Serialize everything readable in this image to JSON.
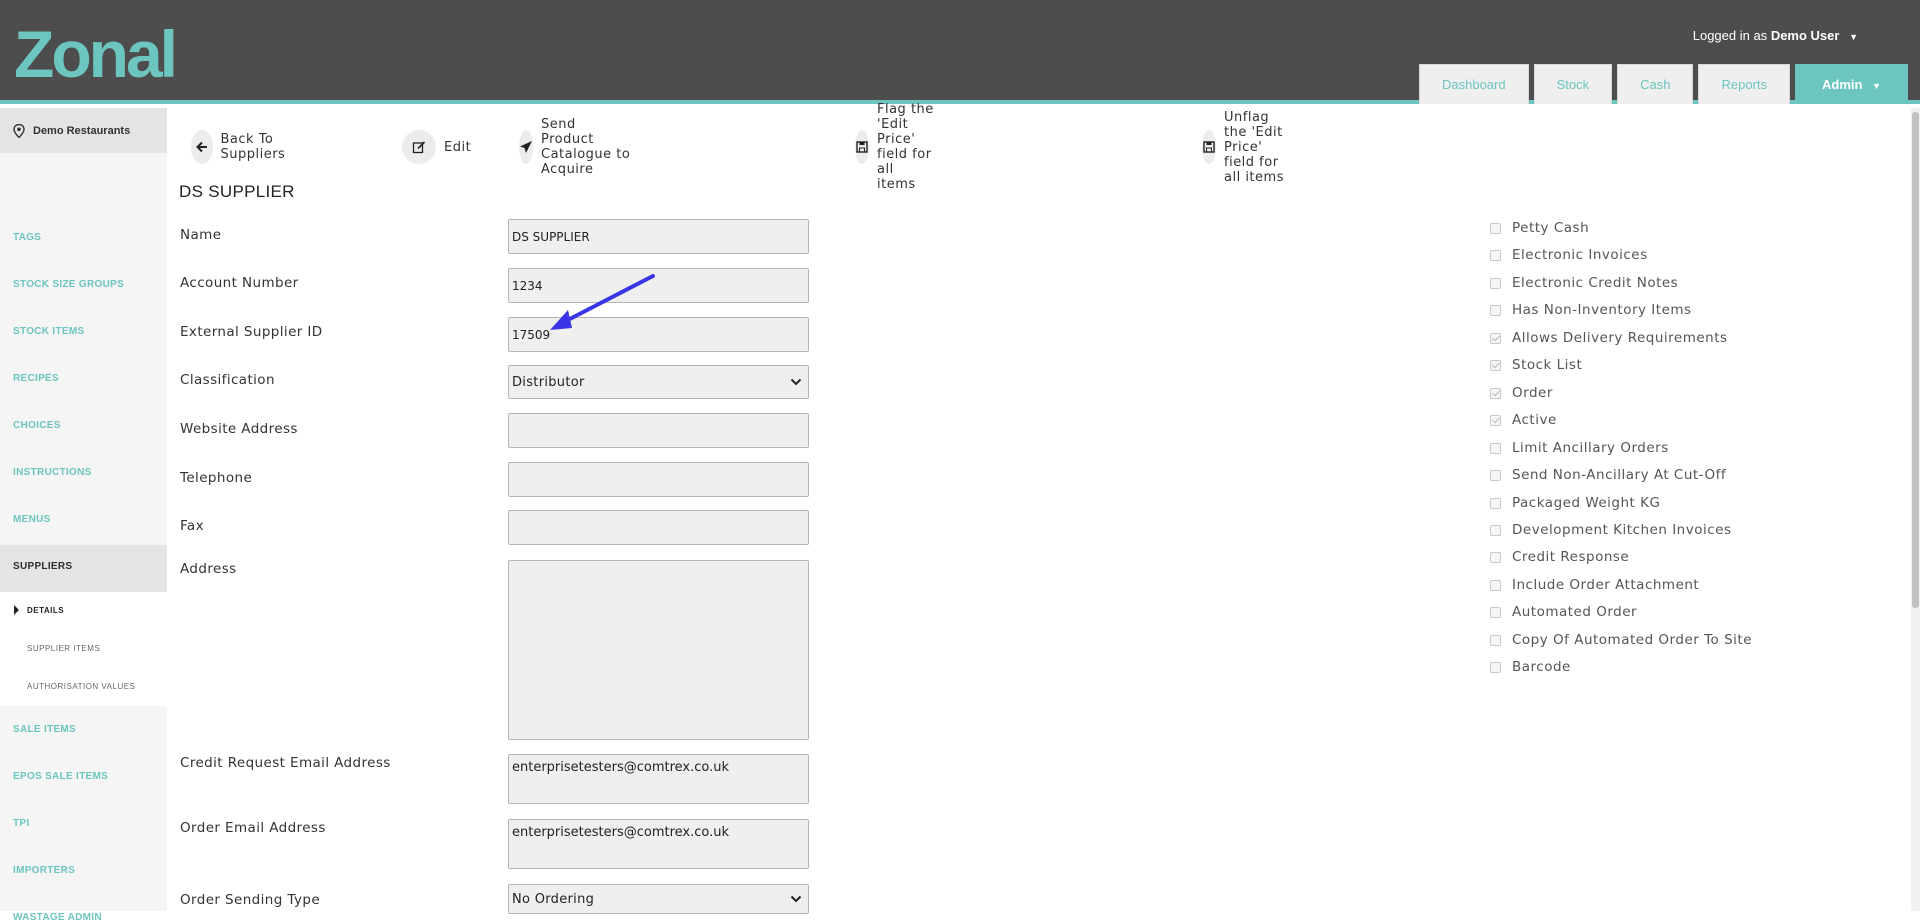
{
  "header": {
    "logo_text": "Zonal",
    "logged_prefix": "Logged in as",
    "logged_user": "Demo User",
    "nav": [
      {
        "label": "Dashboard"
      },
      {
        "label": "Stock"
      },
      {
        "label": "Cash"
      },
      {
        "label": "Reports"
      },
      {
        "label": "Admin"
      }
    ]
  },
  "sidebar": {
    "site_name": "Demo Restaurants",
    "items": [
      {
        "label": "TAGS"
      },
      {
        "label": "STOCK SIZE GROUPS"
      },
      {
        "label": "STOCK ITEMS"
      },
      {
        "label": "RECIPES"
      },
      {
        "label": "CHOICES"
      },
      {
        "label": "INSTRUCTIONS"
      },
      {
        "label": "MENUS"
      },
      {
        "label": "SUPPLIERS"
      },
      {
        "label": "SALE ITEMS"
      },
      {
        "label": "EPOS SALE ITEMS"
      },
      {
        "label": "TPI"
      },
      {
        "label": "IMPORTERS"
      },
      {
        "label": "WASTAGE ADMIN"
      }
    ],
    "sub_items": [
      {
        "label": "DETAILS"
      },
      {
        "label": "SUPPLIER ITEMS"
      },
      {
        "label": "AUTHORISATION VALUES"
      }
    ]
  },
  "toolbar": {
    "back": "Back To Suppliers",
    "edit": "Edit",
    "send": "Send Product Catalogue to Acquire",
    "flag": "Flag the 'Edit Price' field for all items",
    "unflag": "Unflag the 'Edit Price' field for all items"
  },
  "form": {
    "title": "DS SUPPLIER",
    "name_label": "Name",
    "name_value": "DS SUPPLIER",
    "account_label": "Account Number",
    "account_value": "1234",
    "external_label": "External Supplier ID",
    "external_value": "17509",
    "classification_label": "Classification",
    "classification_value": "Distributor",
    "website_label": "Website Address",
    "website_value": "",
    "telephone_label": "Telephone",
    "telephone_value": "",
    "fax_label": "Fax",
    "fax_value": "",
    "address_label": "Address",
    "address_value": "",
    "credit_email_label": "Credit Request Email Address",
    "credit_email_value": "enterprisetesters@comtrex.co.uk",
    "order_email_label": "Order Email Address",
    "order_email_value": "enterprisetesters@comtrex.co.uk",
    "order_sending_label": "Order Sending Type",
    "order_sending_value": "No Ordering"
  },
  "checkboxes": [
    {
      "label": "Petty Cash",
      "checked": false
    },
    {
      "label": "Electronic Invoices",
      "checked": false
    },
    {
      "label": "Electronic Credit Notes",
      "checked": false
    },
    {
      "label": "Has Non-Inventory Items",
      "checked": false
    },
    {
      "label": "Allows Delivery Requirements",
      "checked": true
    },
    {
      "label": "Stock List",
      "checked": true
    },
    {
      "label": "Order",
      "checked": true
    },
    {
      "label": "Active",
      "checked": true
    },
    {
      "label": "Limit Ancillary Orders",
      "checked": false
    },
    {
      "label": "Send Non-Ancillary At Cut-Off",
      "checked": false
    },
    {
      "label": "Packaged Weight KG",
      "checked": false
    },
    {
      "label": "Development Kitchen Invoices",
      "checked": false
    },
    {
      "label": "Credit Response",
      "checked": false
    },
    {
      "label": "Include Order Attachment",
      "checked": false
    },
    {
      "label": "Automated Order",
      "checked": false
    },
    {
      "label": "Copy Of Automated Order To Site",
      "checked": false
    },
    {
      "label": "Barcode",
      "checked": false
    }
  ],
  "colors": {
    "accent": "#6cc5bf",
    "header_bg": "#4d4d4d",
    "annotation_arrow": "#3b35e8"
  }
}
